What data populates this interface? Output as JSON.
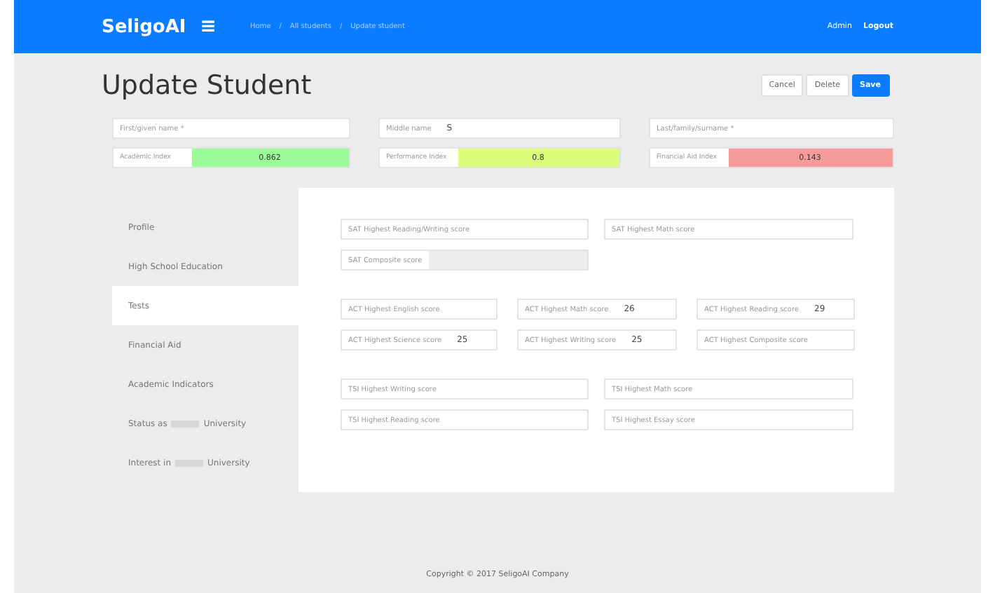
{
  "header": {
    "brand": "SeligoAI",
    "menu_icon": "≡",
    "breadcrumb": [
      "Home",
      "All students",
      "Update student"
    ],
    "breadcrumb_separator": "/",
    "user": "Admin",
    "logout": "Logout"
  },
  "page": {
    "title": "Update Student",
    "buttons": [
      {
        "label": "Cancel",
        "kind": "plain"
      },
      {
        "label": "Delete",
        "kind": "plain"
      },
      {
        "label": "Save",
        "kind": "primary"
      }
    ]
  },
  "summary_fields": [
    {
      "label": "First/given name *"
    },
    {
      "label": "Middle name",
      "value": "S"
    },
    {
      "label": "Last/family/surname *"
    }
  ],
  "indices": [
    {
      "label": "Academic Index",
      "value": "0.862",
      "color": "#9dfc9a"
    },
    {
      "label": "Performance Index",
      "value": "0.8",
      "color": "#dcfc7c"
    },
    {
      "label": "Financial Aid Index",
      "value": "0.143",
      "color": "#f79a9a"
    }
  ],
  "sidebar": {
    "items": [
      {
        "parts": [
          "Profile"
        ],
        "selected": false
      },
      {
        "parts": [
          "High School Education"
        ],
        "selected": false
      },
      {
        "parts": [
          "Tests"
        ],
        "selected": true
      },
      {
        "parts": [
          "Financial Aid"
        ],
        "selected": false
      },
      {
        "parts": [
          "Academic Indicators"
        ],
        "selected": false
      },
      {
        "parts": [
          "Status as",
          "University"
        ],
        "selected": false
      },
      {
        "parts": [
          "Interest in",
          "University"
        ],
        "selected": false
      }
    ]
  },
  "tests": {
    "groups": [
      {
        "fields": [
          {
            "label": "SAT Highest Reading/Writing score",
            "kind": "input"
          },
          {
            "label": "SAT Highest Math score",
            "kind": "input"
          },
          {
            "label": "SAT Composite score",
            "kind": "readonly"
          }
        ]
      },
      {
        "fields": [
          {
            "label": "ACT Highest English score",
            "kind": "input"
          },
          {
            "label": "ACT Highest Math score",
            "value": "26",
            "kind": "input"
          },
          {
            "label": "ACT Highest Reading score",
            "value": "29",
            "kind": "input"
          },
          {
            "label": "ACT Highest Science score",
            "value": "25",
            "kind": "input"
          },
          {
            "label": "ACT Highest Writing score",
            "value": "25",
            "kind": "input"
          },
          {
            "label": "ACT Highest Composite score",
            "kind": "input"
          }
        ]
      },
      {
        "fields": [
          {
            "label": "TSI Highest Writing score",
            "kind": "input"
          },
          {
            "label": "TSI Highest Math score",
            "kind": "input"
          },
          {
            "label": "TSI Highest Reading score",
            "kind": "input"
          },
          {
            "label": "TSI Highest Essay score",
            "kind": "input"
          }
        ]
      }
    ]
  },
  "footer": "Copyright © 2017 SeligoAI Company"
}
